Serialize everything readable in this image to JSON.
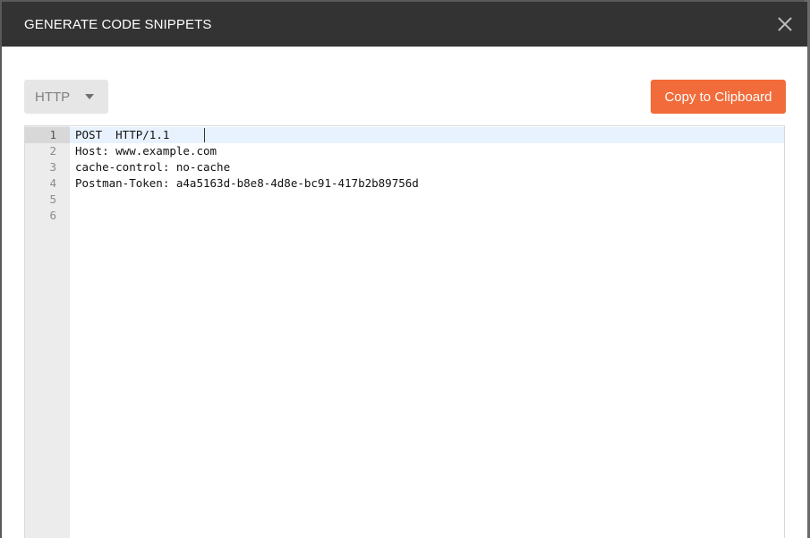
{
  "dialog": {
    "title": "GENERATE CODE SNIPPETS",
    "close_icon": "close-icon"
  },
  "toolbar": {
    "language_selected": "HTTP",
    "language_dropdown_icon": "caret-down-icon",
    "copy_button_label": "Copy to Clipboard"
  },
  "colors": {
    "header_bg": "#333333",
    "accent": "#f26b3a",
    "select_bg": "#e6e6e6",
    "active_line": "#e8f2ff"
  },
  "editor": {
    "lines": [
      {
        "number": "1",
        "text": "POST  HTTP/1.1"
      },
      {
        "number": "2",
        "text": "Host: www.example.com"
      },
      {
        "number": "3",
        "text": "cache-control: no-cache"
      },
      {
        "number": "4",
        "text": "Postman-Token: a4a5163d-b8e8-4d8e-bc91-417b2b89756d"
      },
      {
        "number": "5",
        "text": ""
      },
      {
        "number": "6",
        "text": ""
      }
    ]
  }
}
